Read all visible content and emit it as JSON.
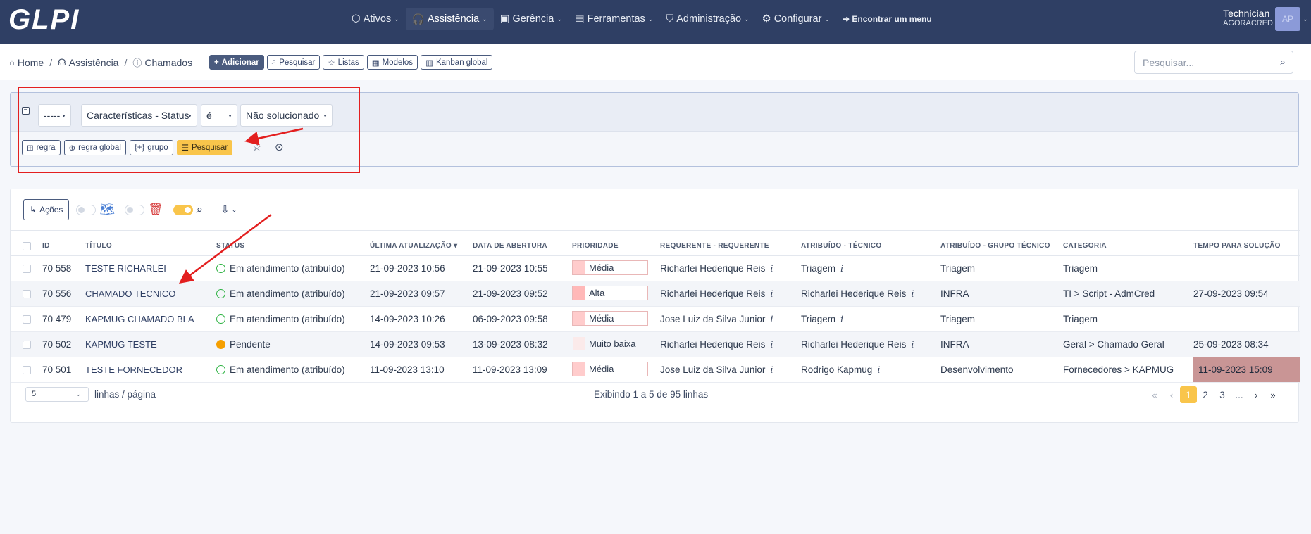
{
  "app": {
    "logo": "GLPI"
  },
  "nav": {
    "items": [
      {
        "label": "Ativos",
        "icon": "cube-icon"
      },
      {
        "label": "Assistência",
        "icon": "headset-icon",
        "active": true
      },
      {
        "label": "Gerência",
        "icon": "wallet-icon"
      },
      {
        "label": "Ferramentas",
        "icon": "briefcase-icon"
      },
      {
        "label": "Administração",
        "icon": "shield-icon"
      },
      {
        "label": "Configurar",
        "icon": "gear-icon"
      }
    ],
    "find_menu": "Encontrar um menu"
  },
  "user": {
    "name": "Technician",
    "entity": "AGORACRED",
    "initials": "AP"
  },
  "breadcrumb": {
    "home": "Home",
    "section": "Assistência",
    "page": "Chamados"
  },
  "toolbar": {
    "add": "Adicionar",
    "search": "Pesquisar",
    "lists": "Listas",
    "templates": "Modelos",
    "kanban": "Kanban global"
  },
  "global_search": {
    "placeholder": "Pesquisar..."
  },
  "criteria": {
    "link": "-----",
    "field": "Características - Status",
    "operator": "é",
    "value": "Não solucionado",
    "buttons": {
      "rule": "regra",
      "global_rule": "regra global",
      "group": "grupo",
      "search": "Pesquisar"
    }
  },
  "results": {
    "actions_label": "Ações",
    "columns": [
      "ID",
      "TÍTULO",
      "STATUS",
      "ÚLTIMA ATUALIZAÇÃO",
      "DATA DE ABERTURA",
      "PRIORIDADE",
      "REQUERENTE - REQUERENTE",
      "ATRIBUÍDO - TÉCNICO",
      "ATRIBUÍDO - GRUPO TÉCNICO",
      "CATEGORIA",
      "TEMPO PARA SOLUÇÃO"
    ],
    "rows": [
      {
        "id": "70 558",
        "title": "TESTE RICHARLEI",
        "status": "Em atendimento (atribuído)",
        "status_type": "open",
        "updated": "21-09-2023 10:56",
        "opened": "21-09-2023 10:55",
        "priority": "Média",
        "priority_color": "#ffcccc",
        "requester": "Richarlei Hederique Reis",
        "technician": "Triagem",
        "group": "Triagem",
        "category": "Triagem",
        "due": "",
        "late": false
      },
      {
        "id": "70 556",
        "title": "CHAMADO TECNICO",
        "status": "Em atendimento (atribuído)",
        "status_type": "open",
        "updated": "21-09-2023 09:57",
        "opened": "21-09-2023 09:52",
        "priority": "Alta",
        "priority_color": "#ffb8b8",
        "requester": "Richarlei Hederique Reis",
        "technician": "Richarlei Hederique Reis",
        "group": "INFRA",
        "category": "TI > Script - AdmCred",
        "due": "27-09-2023 09:54",
        "late": false
      },
      {
        "id": "70 479",
        "title": "KAPMUG CHAMADO BLA",
        "status": "Em atendimento (atribuído)",
        "status_type": "open",
        "updated": "14-09-2023 10:26",
        "opened": "06-09-2023 09:58",
        "priority": "Média",
        "priority_color": "#ffcccc",
        "requester": "Jose Luiz da Silva Junior",
        "technician": "Triagem",
        "group": "Triagem",
        "category": "Triagem",
        "due": "",
        "late": false
      },
      {
        "id": "70 502",
        "title": "KAPMUG TESTE",
        "status": "Pendente",
        "status_type": "pending",
        "updated": "14-09-2023 09:53",
        "opened": "13-09-2023 08:32",
        "priority": "Muito baixa",
        "priority_color": "#fbeaea",
        "requester": "Richarlei Hederique Reis",
        "technician": "Richarlei Hederique Reis",
        "group": "INFRA",
        "category": "Geral > Chamado Geral",
        "due": "25-09-2023 08:34",
        "late": false
      },
      {
        "id": "70 501",
        "title": "TESTE FORNECEDOR",
        "status": "Em atendimento (atribuído)",
        "status_type": "open",
        "updated": "11-09-2023 13:10",
        "opened": "11-09-2023 13:09",
        "priority": "Média",
        "priority_color": "#ffcccc",
        "requester": "Jose Luiz da Silva Junior",
        "technician": "Rodrigo Kapmug",
        "group": "Desenvolvimento",
        "category": "Fornecedores > KAPMUG",
        "due": "11-09-2023 15:09",
        "late": true
      }
    ]
  },
  "pagination": {
    "per_page": "5",
    "per_page_label": "linhas / página",
    "showing": "Exibindo 1 a 5 de 95 linhas",
    "pages": [
      "1",
      "2",
      "3",
      "..."
    ],
    "current_page": "1"
  },
  "annotation_color": "#e31f1f"
}
